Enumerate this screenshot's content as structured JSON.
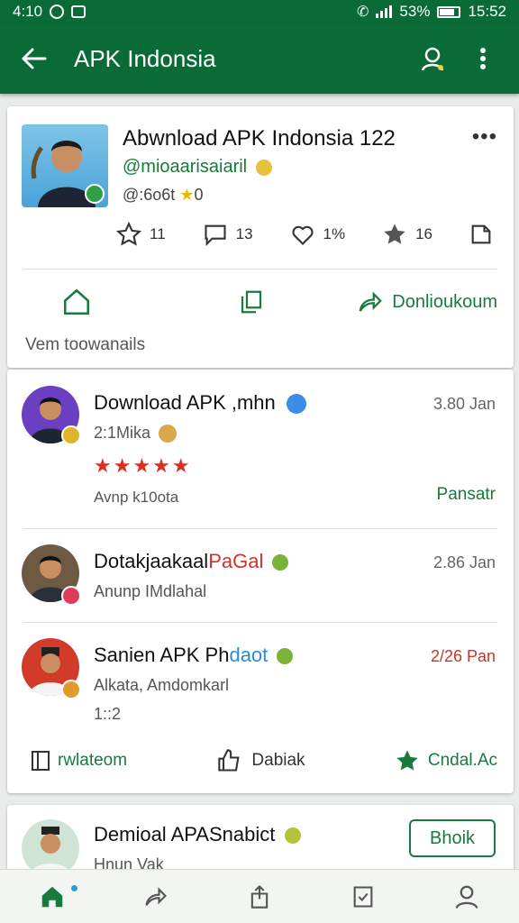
{
  "status_bar": {
    "time_left": "4:10",
    "battery_pct": "53%",
    "time_right": "15:52"
  },
  "app_bar": {
    "title": "APK Indonsia"
  },
  "header_card": {
    "title": "Abwnload APK Indonsia 122",
    "handle": "@mioaarisaiaril",
    "meta": "@:6o6t ",
    "meta_rating": "0",
    "stats": [
      {
        "icon": "star-outline-icon",
        "value": "11"
      },
      {
        "icon": "comment-icon",
        "value": "13"
      },
      {
        "icon": "heart-outline-icon",
        "value": "1%"
      },
      {
        "icon": "star-filled-icon",
        "value": "16"
      },
      {
        "icon": "share-icon",
        "value": ""
      }
    ],
    "actions": [
      {
        "icon": "home-outline-icon",
        "label": ""
      },
      {
        "icon": "copy-icon",
        "label": ""
      },
      {
        "icon": "share-arrow-icon",
        "label": "Donlioukoum"
      }
    ],
    "view_all": "Vem toowanails"
  },
  "list": [
    {
      "title": "Download APK ,mhn",
      "sub": "2:1Mika",
      "time": "3.80 Jan",
      "extra": "Avnp k10ota",
      "action": "Pansatr",
      "rating": "★★★★★"
    },
    {
      "title": "Dotakjaakaal",
      "title_accent": "PaGal",
      "sub": "Anunp IMdlahal",
      "time": "2.86 Jan"
    },
    {
      "title": "Sanien APK Ph",
      "title_accent": "daot",
      "sub": "Alkata, Amdomkarl",
      "extra": "1::2",
      "time": "2/26 Pan"
    }
  ],
  "list_actions": [
    {
      "icon": "book-icon",
      "label": "rwlateom"
    },
    {
      "icon": "like-outline-icon",
      "label": "Dabiak"
    },
    {
      "icon": "star-filled-icon",
      "label": "Cndal.Ac"
    }
  ],
  "bottom_card": {
    "title": "Demioal APASnabict",
    "sub": "Hnun Vak",
    "button": "Bhoik"
  },
  "colors": {
    "primary": "#0b6b37",
    "accent_green": "#187a3c",
    "star_red": "#d93025",
    "link_blue": "#2a8cd8"
  }
}
